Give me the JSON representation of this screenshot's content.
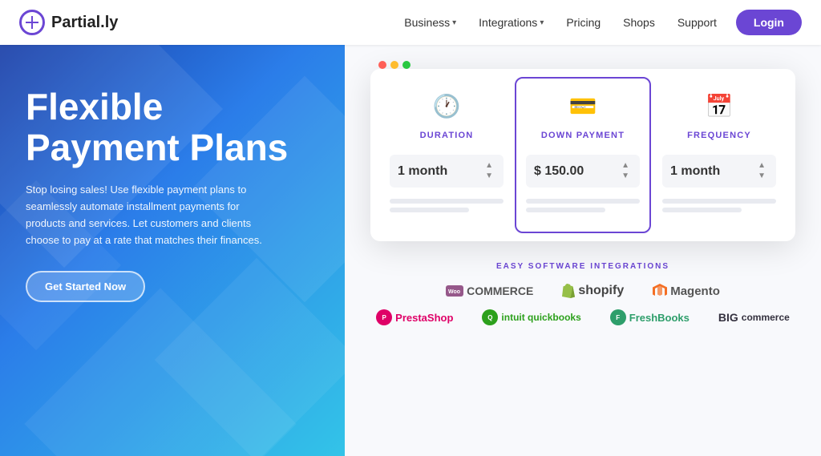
{
  "navbar": {
    "logo_text": "Partial.ly",
    "nav_items": [
      {
        "label": "Business",
        "has_dropdown": true
      },
      {
        "label": "Integrations",
        "has_dropdown": true
      },
      {
        "label": "Pricing",
        "has_dropdown": false
      },
      {
        "label": "Shops",
        "has_dropdown": false
      },
      {
        "label": "Support",
        "has_dropdown": false
      }
    ],
    "login_label": "Login"
  },
  "hero": {
    "title_line1": "Flexible",
    "title_line2": "Payment Plans",
    "description": "Stop losing sales! Use flexible payment plans to seamlessly automate installment payments for products and services. Let customers and clients choose to pay at a rate that matches their finances.",
    "cta_label": "Get Started Now"
  },
  "widget": {
    "cards": [
      {
        "icon": "🕐",
        "label": "DURATION",
        "value": "1 month",
        "active": false
      },
      {
        "icon": "💵",
        "label": "DOWN PAYMENT",
        "value": "$ 150.00",
        "active": true
      },
      {
        "icon": "📅",
        "label": "FREQUENCY",
        "value": "1 month",
        "active": false
      }
    ]
  },
  "integrations": {
    "section_title": "EASY SOFTWARE INTEGRATIONS",
    "row1": [
      {
        "name": "WooCommerce",
        "style": "woo"
      },
      {
        "name": "shopify",
        "style": "shopify"
      },
      {
        "name": "Magento",
        "style": "magento"
      }
    ],
    "row2": [
      {
        "name": "PrestaShop",
        "style": "prestashop"
      },
      {
        "name": "intuit quickbooks",
        "style": "quickbooks"
      },
      {
        "name": "FreshBooks",
        "style": "freshbooks"
      },
      {
        "name": "BigCommerce",
        "style": "bigcommerce"
      }
    ]
  }
}
